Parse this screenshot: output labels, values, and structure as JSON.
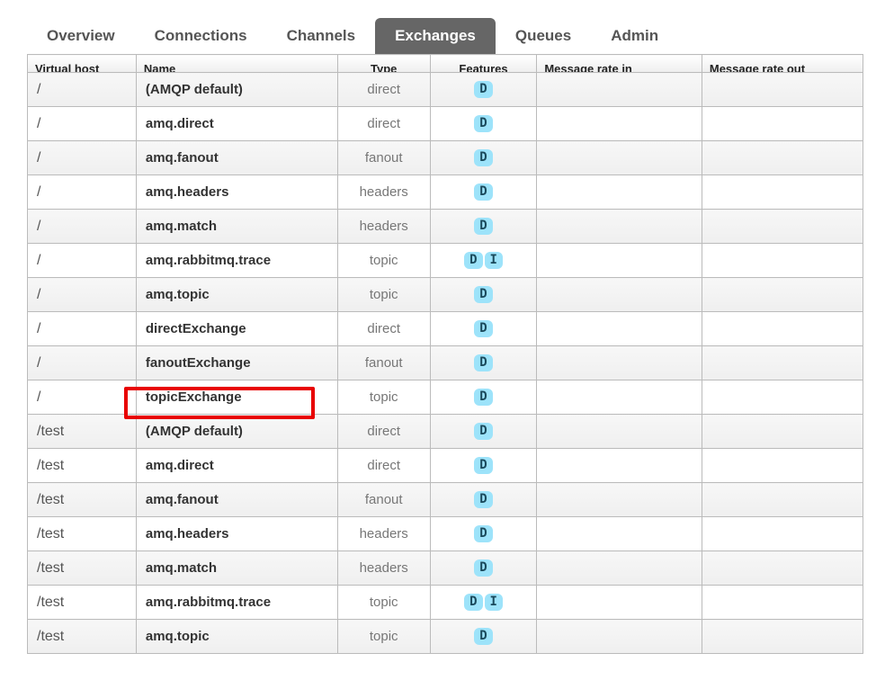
{
  "nav": {
    "tabs": [
      {
        "label": "Overview",
        "active": false
      },
      {
        "label": "Connections",
        "active": false
      },
      {
        "label": "Channels",
        "active": false
      },
      {
        "label": "Exchanges",
        "active": true
      },
      {
        "label": "Queues",
        "active": false
      },
      {
        "label": "Admin",
        "active": false
      }
    ]
  },
  "table": {
    "headers": [
      "Virtual host",
      "Name",
      "Type",
      "Features",
      "Message rate in",
      "Message rate out"
    ],
    "rows": [
      {
        "vhost": "/",
        "name": "(AMQP default)",
        "type": "direct",
        "features": [
          "D"
        ]
      },
      {
        "vhost": "/",
        "name": "amq.direct",
        "type": "direct",
        "features": [
          "D"
        ]
      },
      {
        "vhost": "/",
        "name": "amq.fanout",
        "type": "fanout",
        "features": [
          "D"
        ]
      },
      {
        "vhost": "/",
        "name": "amq.headers",
        "type": "headers",
        "features": [
          "D"
        ]
      },
      {
        "vhost": "/",
        "name": "amq.match",
        "type": "headers",
        "features": [
          "D"
        ]
      },
      {
        "vhost": "/",
        "name": "amq.rabbitmq.trace",
        "type": "topic",
        "features": [
          "D",
          "I"
        ]
      },
      {
        "vhost": "/",
        "name": "amq.topic",
        "type": "topic",
        "features": [
          "D"
        ]
      },
      {
        "vhost": "/",
        "name": "directExchange",
        "type": "direct",
        "features": [
          "D"
        ]
      },
      {
        "vhost": "/",
        "name": "fanoutExchange",
        "type": "fanout",
        "features": [
          "D"
        ]
      },
      {
        "vhost": "/",
        "name": "topicExchange",
        "type": "topic",
        "features": [
          "D"
        ],
        "highlighted": true
      },
      {
        "vhost": "/test",
        "name": "(AMQP default)",
        "type": "direct",
        "features": [
          "D"
        ]
      },
      {
        "vhost": "/test",
        "name": "amq.direct",
        "type": "direct",
        "features": [
          "D"
        ]
      },
      {
        "vhost": "/test",
        "name": "amq.fanout",
        "type": "fanout",
        "features": [
          "D"
        ]
      },
      {
        "vhost": "/test",
        "name": "amq.headers",
        "type": "headers",
        "features": [
          "D"
        ]
      },
      {
        "vhost": "/test",
        "name": "amq.match",
        "type": "headers",
        "features": [
          "D"
        ]
      },
      {
        "vhost": "/test",
        "name": "amq.rabbitmq.trace",
        "type": "topic",
        "features": [
          "D",
          "I"
        ]
      },
      {
        "vhost": "/test",
        "name": "amq.topic",
        "type": "topic",
        "features": [
          "D"
        ]
      }
    ]
  },
  "colors": {
    "tab_active_bg": "#666666",
    "badge_bg": "#9de3fa",
    "highlight_border": "#e80000"
  }
}
